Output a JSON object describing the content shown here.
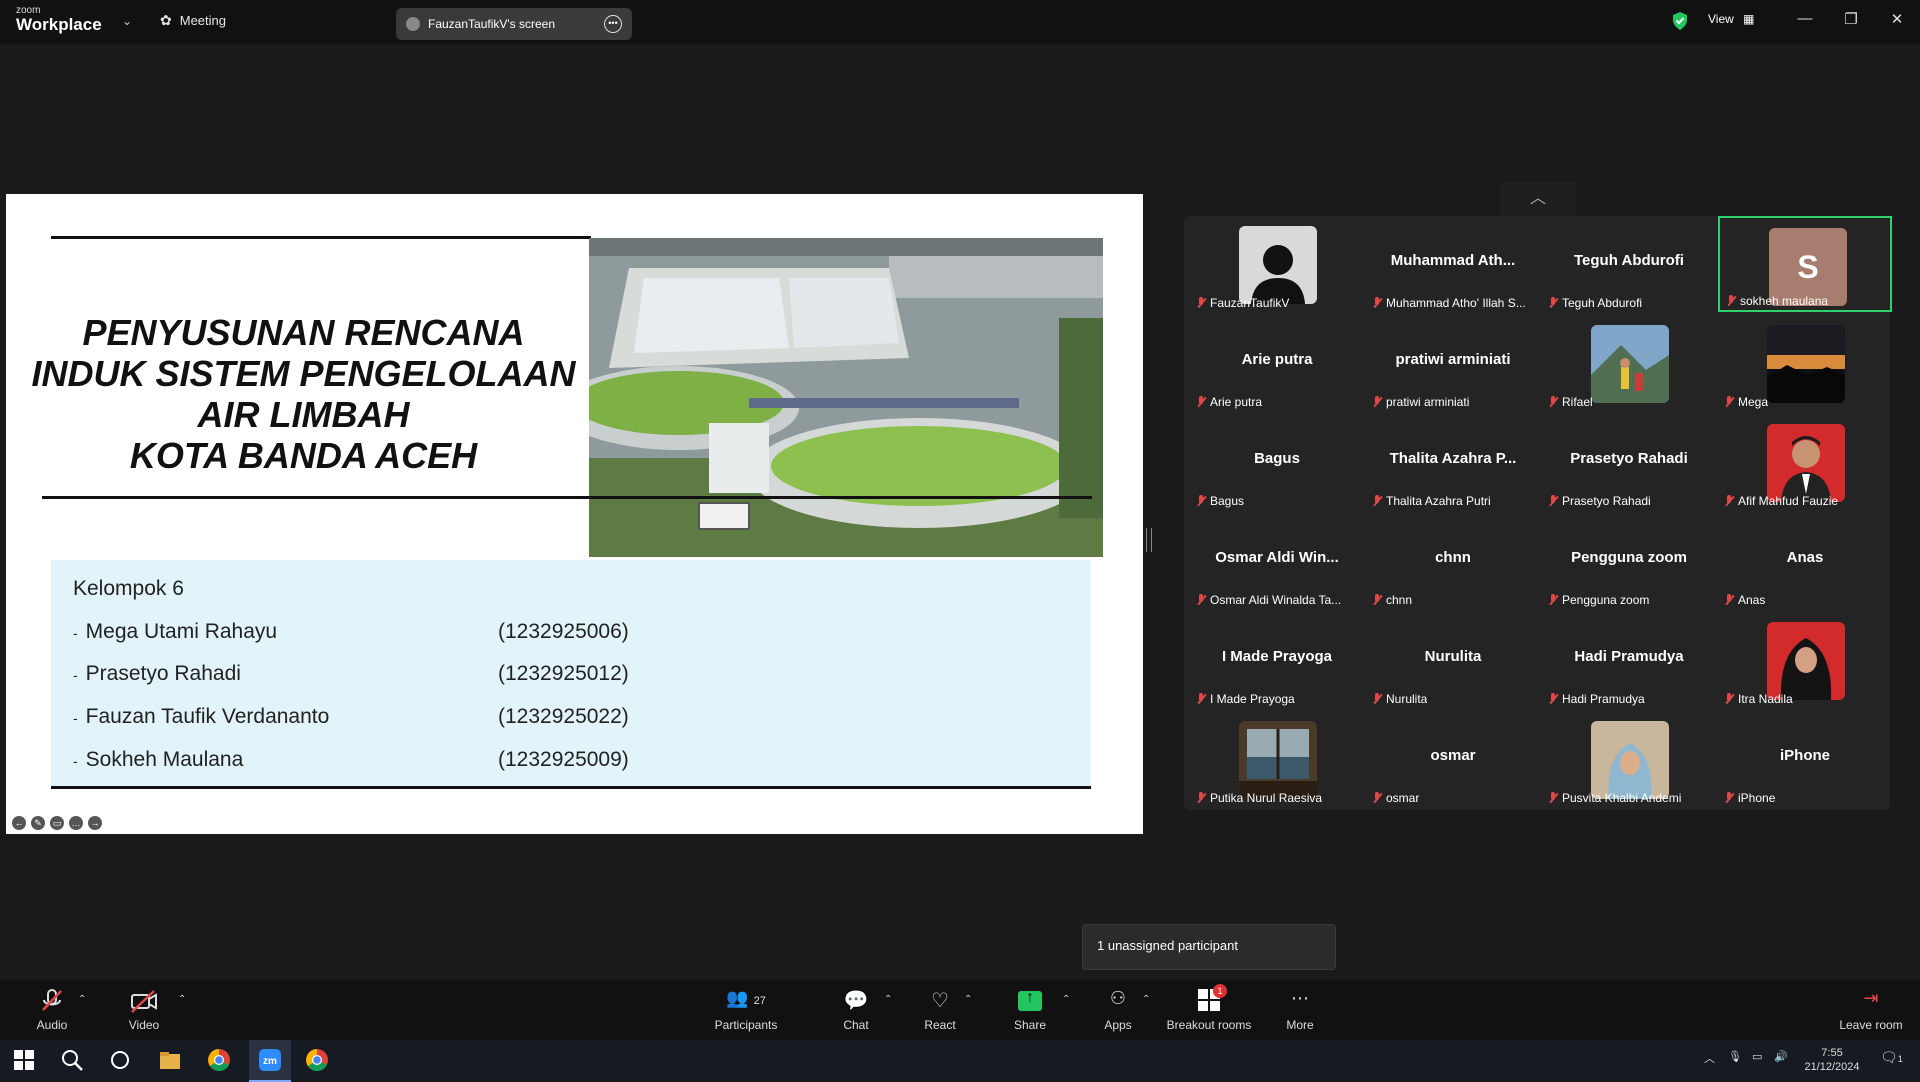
{
  "titlebar": {
    "brand_small": "zoom",
    "brand_big": "Workplace",
    "meeting_label": "Meeting",
    "screen_label": "FauzanTaufikV's screen",
    "view_label": "View"
  },
  "slide": {
    "title_lines": [
      "PENYUSUNAN RENCANA",
      "INDUK SISTEM PENGELOLAAN",
      "AIR LIMBAH",
      "KOTA BANDA ACEH"
    ],
    "group_label": "Kelompok 6",
    "members": [
      {
        "name": "Mega Utami Rahayu",
        "nim": "(1232925006)"
      },
      {
        "name": "Prasetyo Rahadi",
        "nim": "(1232925012)"
      },
      {
        "name": "Fauzan Taufik Verdananto",
        "nim": "(1232925022)"
      },
      {
        "name": "Sokheh Maulana",
        "nim": "(1232925009)"
      }
    ]
  },
  "gallery": [
    {
      "big": "",
      "label": "FauzanTaufikV",
      "avatar": "default"
    },
    {
      "big": "Muhammad  Ath...",
      "label": "Muhammad Atho' Illah S...",
      "avatar": ""
    },
    {
      "big": "Teguh Abdurofi",
      "label": "Teguh Abdurofi",
      "avatar": ""
    },
    {
      "big": "",
      "label": "sokheh maulana",
      "avatar": "letter",
      "letter": "S",
      "active": true
    },
    {
      "big": "Arie putra",
      "label": "Arie putra",
      "avatar": ""
    },
    {
      "big": "pratiwi arminiati",
      "label": "pratiwi arminiati",
      "avatar": ""
    },
    {
      "big": "",
      "label": "Rifael",
      "avatar": "photo-mountain"
    },
    {
      "big": "",
      "label": "Mega",
      "avatar": "photo-sunset"
    },
    {
      "big": "Bagus",
      "label": "Bagus",
      "avatar": ""
    },
    {
      "big": "Thalita Azahra P...",
      "label": "Thalita Azahra Putri",
      "avatar": ""
    },
    {
      "big": "Prasetyo Rahadi",
      "label": "Prasetyo Rahadi",
      "avatar": ""
    },
    {
      "big": "",
      "label": "Afif Mahfud Fauzie",
      "avatar": "photo-red"
    },
    {
      "big": "Osmar  Aldi  Win...",
      "label": "Osmar Aldi Winalda Ta...",
      "avatar": ""
    },
    {
      "big": "chnn",
      "label": "chnn",
      "avatar": ""
    },
    {
      "big": "Pengguna zoom",
      "label": "Pengguna zoom",
      "avatar": ""
    },
    {
      "big": "Anas",
      "label": "Anas",
      "avatar": ""
    },
    {
      "big": "I Made Prayoga",
      "label": "I Made Prayoga",
      "avatar": ""
    },
    {
      "big": "Nurulita",
      "label": "Nurulita",
      "avatar": ""
    },
    {
      "big": "Hadi Pramudya",
      "label": "Hadi Pramudya",
      "avatar": ""
    },
    {
      "big": "",
      "label": "Itra Nadila",
      "avatar": "photo-red-hijab"
    },
    {
      "big": "",
      "label": "Putika Nurul Raesiva",
      "avatar": "photo-window"
    },
    {
      "big": "osmar",
      "label": "osmar",
      "avatar": ""
    },
    {
      "big": "",
      "label": "Pusvita Khalbi Andemi",
      "avatar": "photo-hijab"
    },
    {
      "big": "iPhone",
      "label": "iPhone",
      "avatar": ""
    }
  ],
  "tooltip": "1 unassigned participant",
  "toolbar": {
    "audio": "Audio",
    "video": "Video",
    "participants": "Participants",
    "participants_count": "27",
    "chat": "Chat",
    "react": "React",
    "share": "Share",
    "apps": "Apps",
    "breakout": "Breakout rooms",
    "breakout_badge": "1",
    "more": "More",
    "leave": "Leave room"
  },
  "taskbar": {
    "time": "7:55",
    "date": "21/12/2024",
    "notif_count": "1"
  },
  "colors": {
    "accent_green": "#2fd16f",
    "muted_red": "#e04848",
    "members_bg": "#e2f4f9"
  }
}
